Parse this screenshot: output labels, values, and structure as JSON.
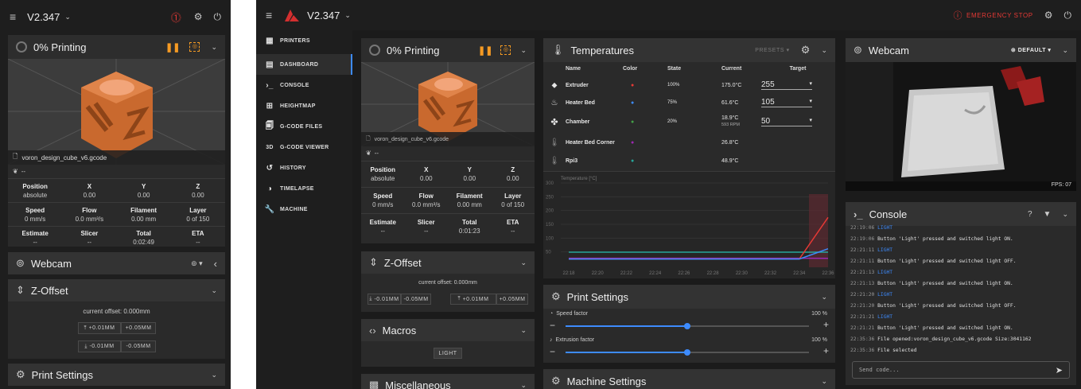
{
  "mobile": {
    "title": "V2.347",
    "printing_status": "0% Printing",
    "filename": "voron_design_cube_v6.gcode",
    "fan_label": "--",
    "position_headers": [
      "Position",
      "X",
      "Y",
      "Z"
    ],
    "position_values": [
      "absolute",
      "0.00",
      "0.00",
      "0.00"
    ],
    "speed_headers": [
      "Speed",
      "Flow",
      "Filament",
      "Layer"
    ],
    "speed_values": [
      "0 mm/s",
      "0.0 mm³/s",
      "0.00 mm",
      "0 of 150"
    ],
    "estimate_headers": [
      "Estimate",
      "Slicer",
      "Total",
      "ETA"
    ],
    "estimate_values": [
      "--",
      "--",
      "0:02:49",
      "--"
    ],
    "webcam_title": "Webcam",
    "zoffset_title": "Z-Offset",
    "current_offset": "current offset: 0.000mm",
    "btn_up_small": "+0.01MM",
    "btn_up_large": "+0.05MM",
    "btn_down_small": "-0.01MM",
    "btn_down_large": "-0.05MM",
    "print_settings_title": "Print Settings"
  },
  "desktop": {
    "title": "V2.347",
    "emergency_stop": "EMERGENCY STOP",
    "nav": [
      "PRINTERS",
      "DASHBOARD",
      "CONSOLE",
      "HEIGHTMAP",
      "G-CODE FILES",
      "G-CODE VIEWER",
      "HISTORY",
      "TIMELAPSE",
      "MACHINE"
    ],
    "status": {
      "printing_status": "0% Printing",
      "filename": "voron_design_cube_v6.gcode",
      "fan_label": "--",
      "position_headers": [
        "Position",
        "X",
        "Y",
        "Z"
      ],
      "position_values": [
        "absolute",
        "0.00",
        "0.00",
        "0.00"
      ],
      "speed_headers": [
        "Speed",
        "Flow",
        "Filament",
        "Layer"
      ],
      "speed_values": [
        "0 mm/s",
        "0.0 mm³/s",
        "0.00 mm",
        "0 of 150"
      ],
      "estimate_headers": [
        "Estimate",
        "Slicer",
        "Total",
        "ETA"
      ],
      "estimate_values": [
        "--",
        "--",
        "0:01:23",
        "--"
      ]
    },
    "zoffset": {
      "title": "Z-Offset",
      "current_offset": "current offset: 0.000mm",
      "btn_down_small": "-0.01MM",
      "btn_down_large": "-0.05MM",
      "btn_up_small": "+0.01MM",
      "btn_up_large": "+0.05MM"
    },
    "macros": {
      "title": "Macros",
      "light": "LIGHT"
    },
    "misc_title": "Miscellaneous",
    "temps": {
      "title": "Temperatures",
      "presets": "PRESETS",
      "headers": [
        "Name",
        "Color",
        "State",
        "Current",
        "Target"
      ],
      "rows": [
        {
          "name": "Extruder",
          "color": "#e53935",
          "state": "100%",
          "current": "175.0°C",
          "current2": "",
          "target": "255"
        },
        {
          "name": "Heater Bed",
          "color": "#3d8bfd",
          "state": "75%",
          "current": "61.6°C",
          "current2": "",
          "target": "105"
        },
        {
          "name": "Chamber",
          "color": "#43a047",
          "state": "20%",
          "current": "18.9°C",
          "current2": "593 RPM",
          "target": "50"
        },
        {
          "name": "Heater Bed Corner",
          "color": "#9c27b0",
          "state": "",
          "current": "26.8°C",
          "current2": "",
          "target": ""
        },
        {
          "name": "Rpi3",
          "color": "#26a69a",
          "state": "",
          "current": "48.9°C",
          "current2": "",
          "target": ""
        }
      ]
    },
    "chart_data": {
      "type": "line",
      "ylabel": "Temperature [°C]",
      "ylim": [
        0,
        300
      ],
      "y_ticks": [
        "300",
        "250",
        "200",
        "150",
        "100",
        "50"
      ],
      "categories": [
        "22:18",
        "22:20",
        "22:22",
        "22:24",
        "22:26",
        "22:28",
        "22:30",
        "22:32",
        "22:34",
        "22:36"
      ],
      "series": [
        {
          "color": "#26a69a",
          "values": [
            49,
            49,
            49,
            49,
            49,
            49,
            49,
            49,
            49,
            48.9
          ]
        },
        {
          "color": "#9c27b0",
          "values": [
            27,
            27,
            27,
            27,
            27,
            27,
            27,
            27,
            27,
            26.8
          ]
        },
        {
          "color": "#e53935",
          "values": [
            24,
            24,
            24,
            24,
            24,
            24,
            24,
            24,
            24,
            175
          ]
        },
        {
          "color": "#3d8bfd",
          "values": [
            24,
            24,
            24,
            24,
            24,
            24,
            24,
            24,
            24,
            61.6
          ]
        }
      ],
      "grid": true
    },
    "print_settings": {
      "title": "Print Settings",
      "speed_label": "Speed factor",
      "speed_value": "100 %",
      "speed_fraction": 0.5,
      "extrusion_label": "Extrusion factor",
      "extrusion_value": "100 %",
      "extrusion_fraction": 0.5
    },
    "machine_settings_title": "Machine Settings",
    "webcam": {
      "title": "Webcam",
      "default": "DEFAULT",
      "fps": "FPS: 07"
    },
    "console": {
      "title": "Console",
      "help": "?",
      "placeholder": "Send code...",
      "lines": [
        {
          "ts": "22:19:06",
          "text": "LIGHT",
          "light": true
        },
        {
          "ts": "22:19:06",
          "text": "Button 'Light' pressed and switched light ON.",
          "light": false
        },
        {
          "ts": "22:21:11",
          "text": "LIGHT",
          "light": true
        },
        {
          "ts": "22:21:11",
          "text": "Button 'Light' pressed and switched light OFF.",
          "light": false
        },
        {
          "ts": "22:21:13",
          "text": "LIGHT",
          "light": true
        },
        {
          "ts": "22:21:13",
          "text": "Button 'Light' pressed and switched light ON.",
          "light": false
        },
        {
          "ts": "22:21:20",
          "text": "LIGHT",
          "light": true
        },
        {
          "ts": "22:21:20",
          "text": "Button 'Light' pressed and switched light OFF.",
          "light": false
        },
        {
          "ts": "22:21:21",
          "text": "LIGHT",
          "light": true
        },
        {
          "ts": "22:21:21",
          "text": "Button 'Light' pressed and switched light ON.",
          "light": false
        },
        {
          "ts": "22:35:36",
          "text": "File opened:voron_design_cube_v6.gcode Size:3041162",
          "light": false
        },
        {
          "ts": "22:35:36",
          "text": "File selected",
          "light": false
        }
      ]
    }
  }
}
